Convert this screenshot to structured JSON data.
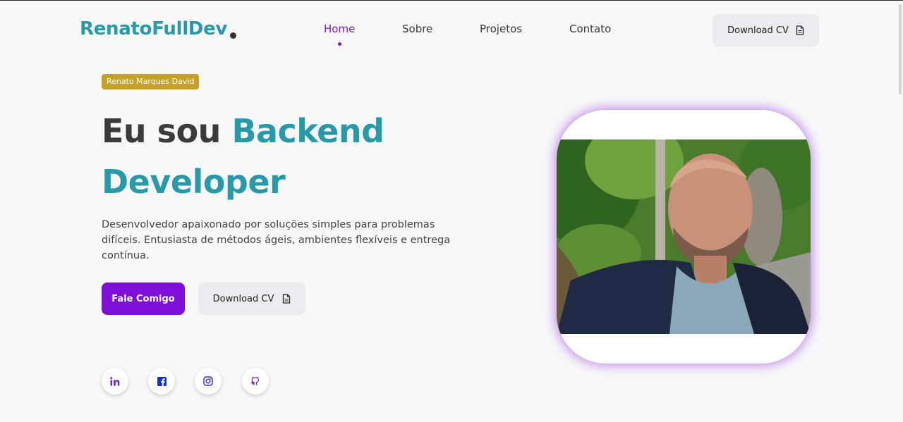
{
  "header": {
    "logo": "RenatoFullDev",
    "nav": [
      "Home",
      "Sobre",
      "Projetos",
      "Contato"
    ],
    "active_nav": "Home",
    "download_cv": "Download CV"
  },
  "hero": {
    "badge": "Renato Marques David",
    "headline_prefix": "Eu sou",
    "headline_accent_1": "Backend",
    "headline_accent_2": "Developer",
    "description": "Desenvolvedor apaixonado por soluções simples para problemas difíceis. Entusiasta de métodos ágeis, ambientes flexíveis e entrega contínua.",
    "primary_button": "Fale Comigo",
    "secondary_button": "Download CV"
  },
  "social": [
    {
      "icon": "linkedin-icon"
    },
    {
      "icon": "facebook-icon"
    },
    {
      "icon": "instagram-icon"
    },
    {
      "icon": "github-icon"
    }
  ],
  "colors": {
    "accent_teal": "#2899a8",
    "accent_purple": "#7e0fd7",
    "badge_gold": "#c3a12b",
    "background": "#f8f8f9"
  }
}
